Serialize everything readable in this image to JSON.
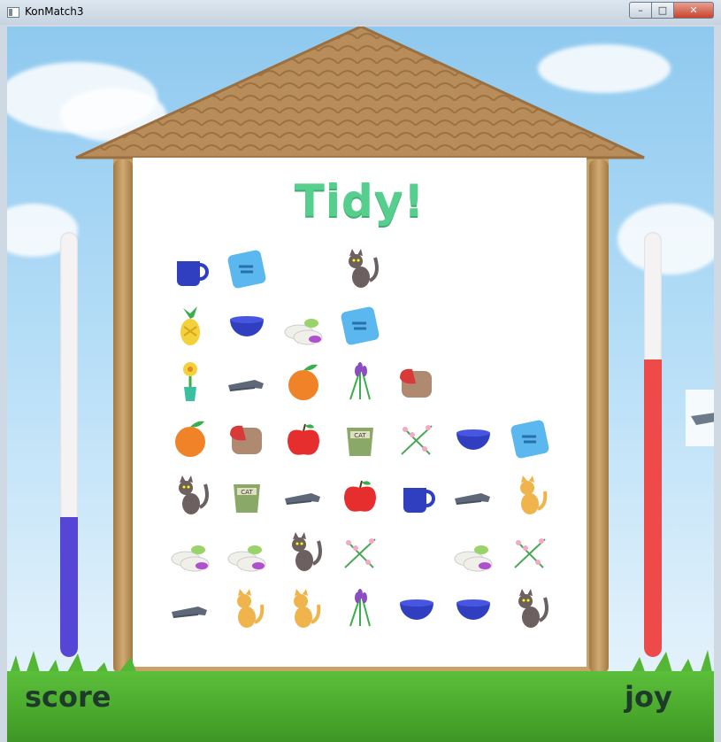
{
  "window": {
    "title": "KonMatch3",
    "min_glyph": "–",
    "max_glyph": "□",
    "close_glyph": "✕"
  },
  "game": {
    "title": "Tidy!",
    "score_label": "score",
    "joy_label": "joy",
    "score_level": 0.33,
    "joy_level": 0.7,
    "colors": {
      "score_fill": "#5546d6",
      "joy_fill": "#ee4a4a",
      "title": "#56cf8e"
    },
    "grid": {
      "rows": 7,
      "cols": 7,
      "cells": [
        [
          "mug-icon",
          "book-icon",
          "empty",
          "cat-icon",
          "empty",
          "empty",
          "empty"
        ],
        [
          "pineapple-icon",
          "bowl-icon",
          "slippers-icon",
          "book-icon",
          "empty",
          "empty",
          "empty"
        ],
        [
          "flower-vase-icon",
          "socks-icon",
          "orange-icon",
          "lavender-icon",
          "toast-icon",
          "empty",
          "empty"
        ],
        [
          "orange-icon",
          "toast-icon",
          "apple-icon",
          "catfood-icon",
          "blossom-icon",
          "bowl-icon",
          "book-icon"
        ],
        [
          "cat-icon",
          "catfood-icon",
          "socks-icon",
          "apple-icon",
          "mug-icon",
          "socks-icon",
          "kitten-icon"
        ],
        [
          "slippers-icon",
          "slippers-icon",
          "cat-icon",
          "blossom-icon",
          "empty",
          "slippers-icon",
          "blossom-icon"
        ],
        [
          "socks-icon",
          "kitten-icon",
          "kitten-icon",
          "lavender-icon",
          "bowl-icon",
          "bowl-icon",
          "cat-icon"
        ]
      ]
    }
  }
}
